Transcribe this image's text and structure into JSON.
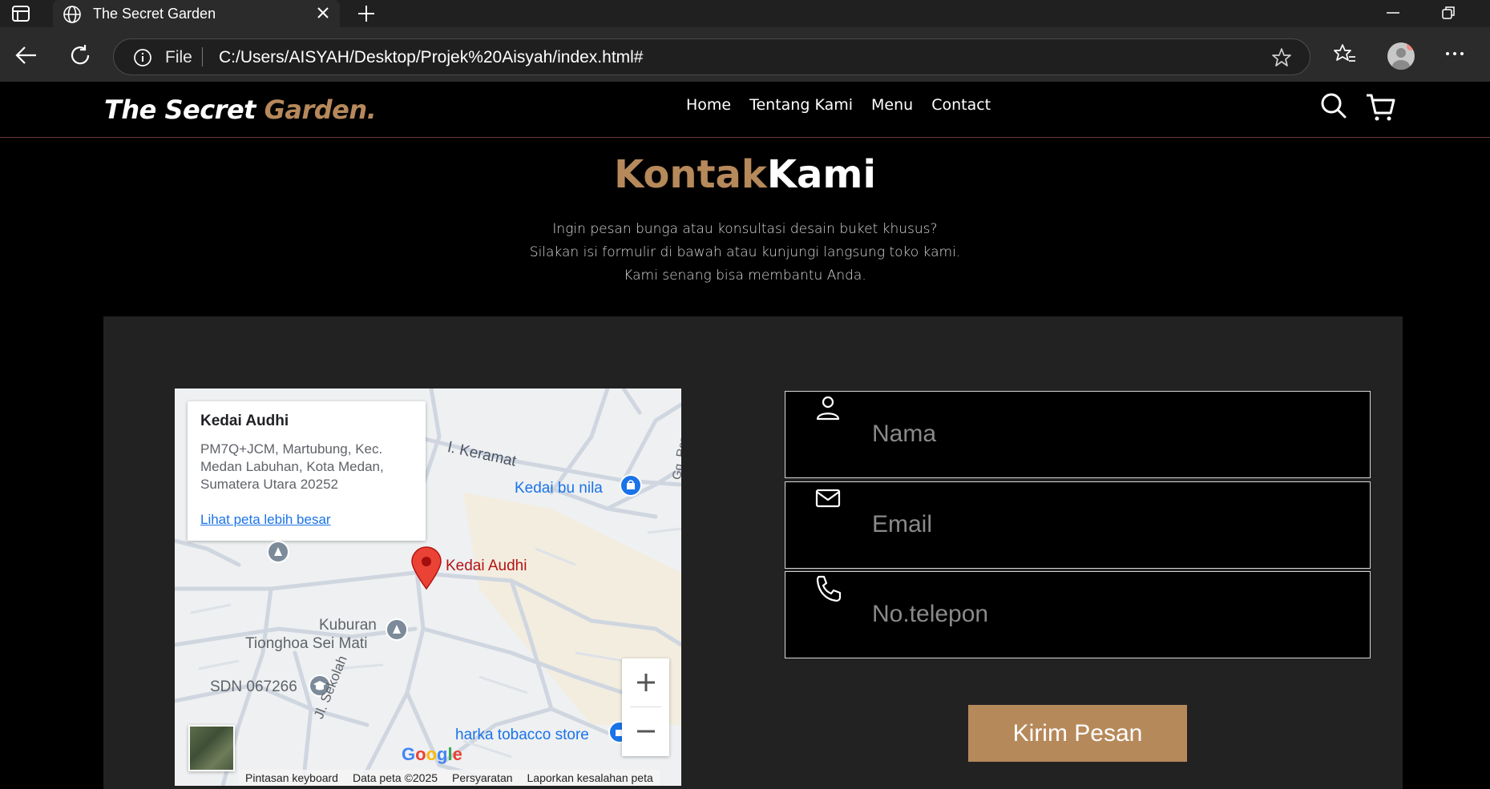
{
  "browser": {
    "tab_title": "The Secret Garden",
    "address_prefix": "File",
    "url": "C:/Users/AISYAH/Desktop/Projek%20Aisyah/index.html#",
    "icons": [
      "tab-actions-icon",
      "globe-icon",
      "close-icon",
      "plus-icon",
      "minimize-icon",
      "restore-icon",
      "back-icon",
      "refresh-icon",
      "info-icon",
      "star-icon",
      "favorites-icon",
      "profile-icon",
      "more-icon"
    ]
  },
  "site": {
    "logo_main": "The Secret ",
    "logo_accent": "Garden.",
    "nav": [
      "Home",
      "Tentang Kami",
      "Menu",
      "Contact"
    ],
    "accent_color": "#b6895b",
    "icons": [
      "search-icon",
      "cart-icon"
    ]
  },
  "contact": {
    "heading_accent": "Kontak",
    "heading_main": "Kami",
    "description_lines": [
      "Ingin pesan bunga atau konsultasi desain buket khusus?",
      "Silakan isi formulir di bawah atau kunjungi langsung toko kami.",
      "Kami senang bisa membantu Anda."
    ]
  },
  "map": {
    "place_name": "Kedai Audhi",
    "address": "PM7Q+JCM, Martubung, Kec. Medan Labuhan, Kota Medan, Sumatera Utara 20252",
    "larger_map_link": "Lihat peta lebih besar",
    "labels": {
      "street_keramat": "l. Keramat",
      "kedai_bu_nila": "Kedai bu nila",
      "gg_rezeki": "Gg. Reze",
      "pin_label": "Kedai Audhi",
      "kuburan_1": "Kuburan",
      "kuburan_2": "Tionghoa Sei Mati",
      "sdn": "SDN 067266",
      "jl_sekolah": "Jl. Sekolah",
      "harka": "harka tobacco store"
    },
    "google_logo": "Google",
    "attribution": [
      "Pintasan keyboard",
      "Data peta ©2025",
      "Persyaratan",
      "Laporkan kesalahan peta"
    ]
  },
  "form": {
    "name_placeholder": "Nama",
    "email_placeholder": "Email",
    "phone_placeholder": "No.telepon",
    "submit_label": "Kirim Pesan",
    "icons": [
      "user-icon",
      "mail-icon",
      "phone-icon"
    ]
  }
}
